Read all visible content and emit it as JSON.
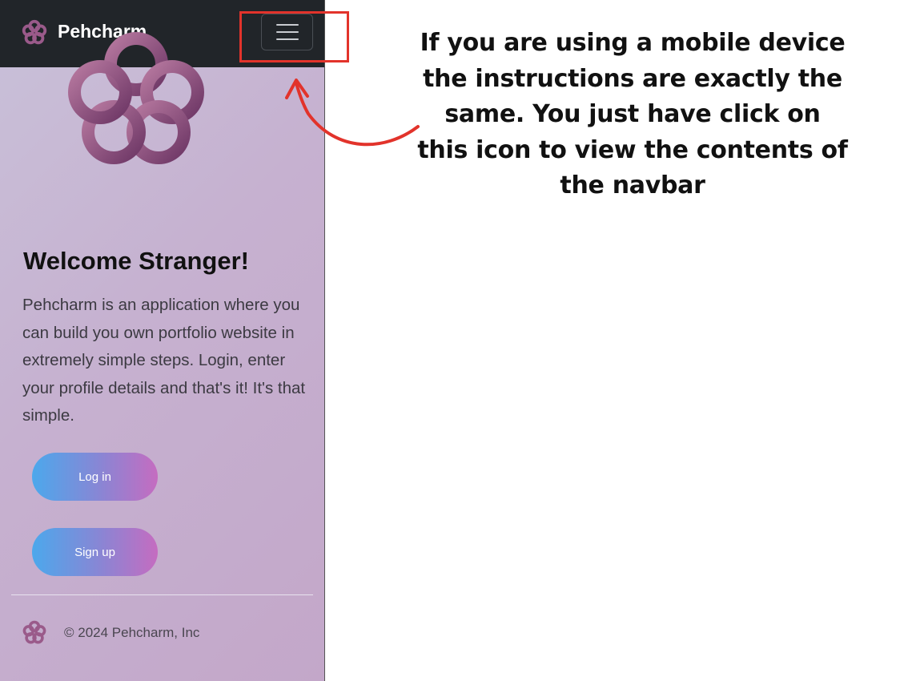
{
  "navbar": {
    "brand_name": "Pehcharm",
    "brand_logo_icon": "knot-flower-logo",
    "menu_toggle_icon": "hamburger-menu-icon"
  },
  "hero": {
    "logo_icon": "knot-flower-logo",
    "title": "Welcome Stranger!",
    "description": "Pehcharm is an application where you can build you own portfolio website in extremely simple steps. Login, enter your profile details and that's it! It's that simple."
  },
  "buttons": {
    "login_label": "Log in",
    "signup_label": "Sign up"
  },
  "footer": {
    "logo_icon": "knot-flower-logo",
    "copyright": "© 2024 Pehcharm, Inc"
  },
  "annotation": {
    "instruction": "If you are using a mobile device the instructions are exactly the same. You just have click on this icon to view the contents of the navbar",
    "highlight_color": "#e2332b"
  },
  "colors": {
    "navbar_bg": "#212529",
    "button_gradient_start": "#4ca8ec",
    "button_gradient_end": "#c56cc0",
    "logo_color": "#8e4f7e"
  }
}
